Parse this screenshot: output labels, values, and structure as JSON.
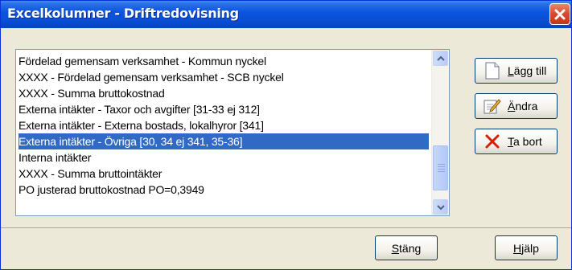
{
  "window": {
    "title": "Excelkolumner - Driftredovisning"
  },
  "list": {
    "items": [
      "Fördelad gemensam verksamhet - Kommun nyckel",
      "XXXX - Fördelad gemensam verksamhet - SCB nyckel",
      "XXXX - Summa bruttokostnad",
      "Externa intäkter - Taxor och avgifter [31-33 ej 312]",
      "Externa intäkter - Externa bostads, lokalhyror [341]",
      "Externa intäkter - Övriga [30, 34 ej 341, 35-36]",
      "Interna intäkter",
      "XXXX - Summa bruttointäkter",
      "PO justerad bruttokostnad PO=0,3949"
    ],
    "selected_index": 5
  },
  "buttons": {
    "add": {
      "accel": "L",
      "rest": "ägg till",
      "icon": "new-document-icon"
    },
    "edit": {
      "accel": "Ä",
      "rest": "ndra",
      "icon": "edit-document-icon"
    },
    "delete": {
      "accel": "T",
      "rest": "a bort",
      "icon": "red-x-icon"
    },
    "close": {
      "accel": "S",
      "rest": "täng"
    },
    "help": {
      "accel": "H",
      "rest": "jälp"
    }
  },
  "colors": {
    "selection": "#316ac5",
    "titlebar": "#0a4fd6",
    "close_button": "#d8492c",
    "delete_icon": "#d81e05"
  }
}
